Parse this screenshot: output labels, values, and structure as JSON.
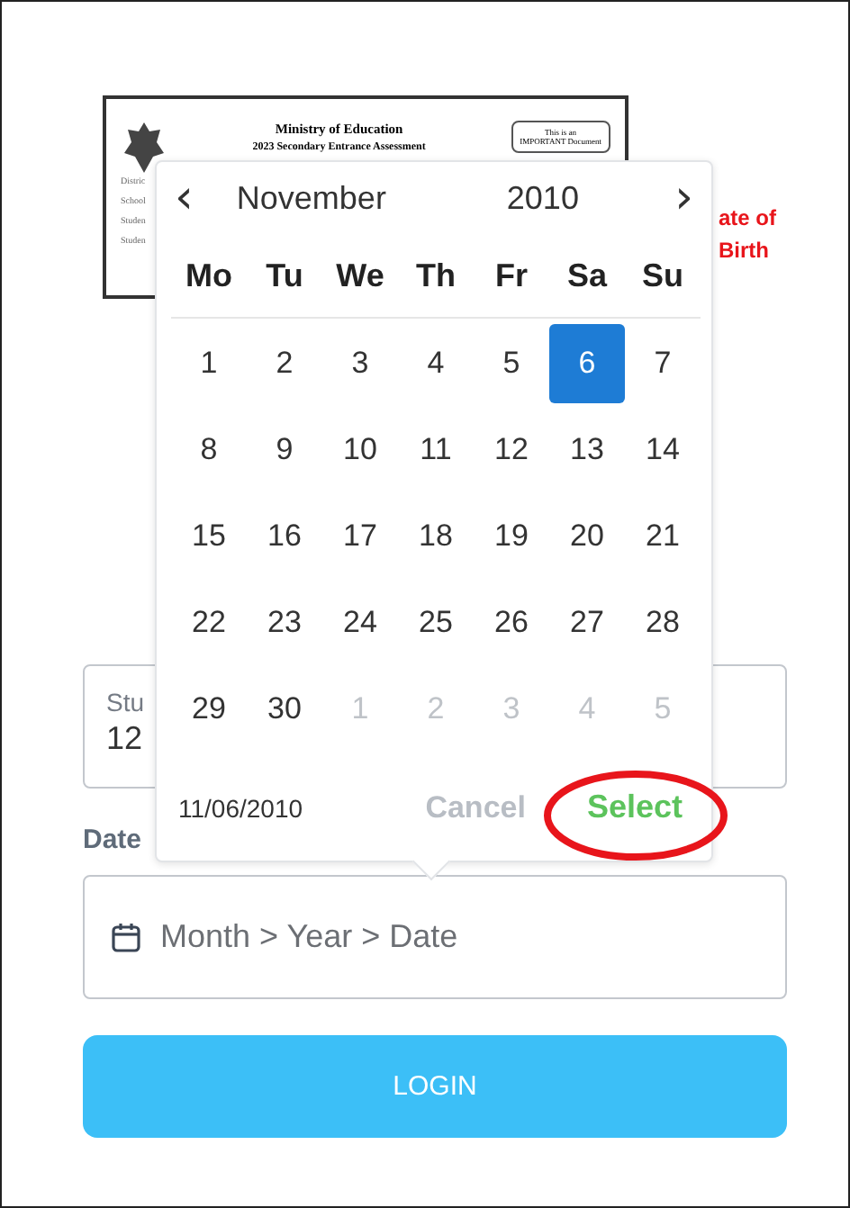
{
  "document_image": {
    "title": "Ministry of Education",
    "subtitle": "2023 Secondary Entrance Assessment",
    "stamp": [
      "This is an",
      "IMPORTANT Document"
    ],
    "field_labels": [
      "Distric",
      "School",
      "Studen",
      "Studen"
    ]
  },
  "side_note": [
    "ate of",
    "Birth"
  ],
  "student_field": {
    "label": "Stu",
    "value": "12"
  },
  "date_label": "Date",
  "date_field": {
    "placeholder": "Month > Year > Date"
  },
  "login_button": "LOGIN",
  "date_picker": {
    "prev": "‹",
    "next": "›",
    "month": "November",
    "year": "2010",
    "weekdays": [
      "Mo",
      "Tu",
      "We",
      "Th",
      "Fr",
      "Sa",
      "Su"
    ],
    "weeks": [
      [
        {
          "day": "1",
          "in_month": true,
          "selected": false
        },
        {
          "day": "2",
          "in_month": true,
          "selected": false
        },
        {
          "day": "3",
          "in_month": true,
          "selected": false
        },
        {
          "day": "4",
          "in_month": true,
          "selected": false
        },
        {
          "day": "5",
          "in_month": true,
          "selected": false
        },
        {
          "day": "6",
          "in_month": true,
          "selected": true
        },
        {
          "day": "7",
          "in_month": true,
          "selected": false
        }
      ],
      [
        {
          "day": "8",
          "in_month": true,
          "selected": false
        },
        {
          "day": "9",
          "in_month": true,
          "selected": false
        },
        {
          "day": "10",
          "in_month": true,
          "selected": false
        },
        {
          "day": "11",
          "in_month": true,
          "selected": false
        },
        {
          "day": "12",
          "in_month": true,
          "selected": false
        },
        {
          "day": "13",
          "in_month": true,
          "selected": false
        },
        {
          "day": "14",
          "in_month": true,
          "selected": false
        }
      ],
      [
        {
          "day": "15",
          "in_month": true,
          "selected": false
        },
        {
          "day": "16",
          "in_month": true,
          "selected": false
        },
        {
          "day": "17",
          "in_month": true,
          "selected": false
        },
        {
          "day": "18",
          "in_month": true,
          "selected": false
        },
        {
          "day": "19",
          "in_month": true,
          "selected": false
        },
        {
          "day": "20",
          "in_month": true,
          "selected": false
        },
        {
          "day": "21",
          "in_month": true,
          "selected": false
        }
      ],
      [
        {
          "day": "22",
          "in_month": true,
          "selected": false
        },
        {
          "day": "23",
          "in_month": true,
          "selected": false
        },
        {
          "day": "24",
          "in_month": true,
          "selected": false
        },
        {
          "day": "25",
          "in_month": true,
          "selected": false
        },
        {
          "day": "26",
          "in_month": true,
          "selected": false
        },
        {
          "day": "27",
          "in_month": true,
          "selected": false
        },
        {
          "day": "28",
          "in_month": true,
          "selected": false
        }
      ],
      [
        {
          "day": "29",
          "in_month": true,
          "selected": false
        },
        {
          "day": "30",
          "in_month": true,
          "selected": false
        },
        {
          "day": "1",
          "in_month": false,
          "selected": false
        },
        {
          "day": "2",
          "in_month": false,
          "selected": false
        },
        {
          "day": "3",
          "in_month": false,
          "selected": false
        },
        {
          "day": "4",
          "in_month": false,
          "selected": false
        },
        {
          "day": "5",
          "in_month": false,
          "selected": false
        }
      ]
    ],
    "selected_date": "11/06/2010",
    "cancel": "Cancel",
    "select": {
      "label": "Select",
      "highlighted": true
    }
  }
}
